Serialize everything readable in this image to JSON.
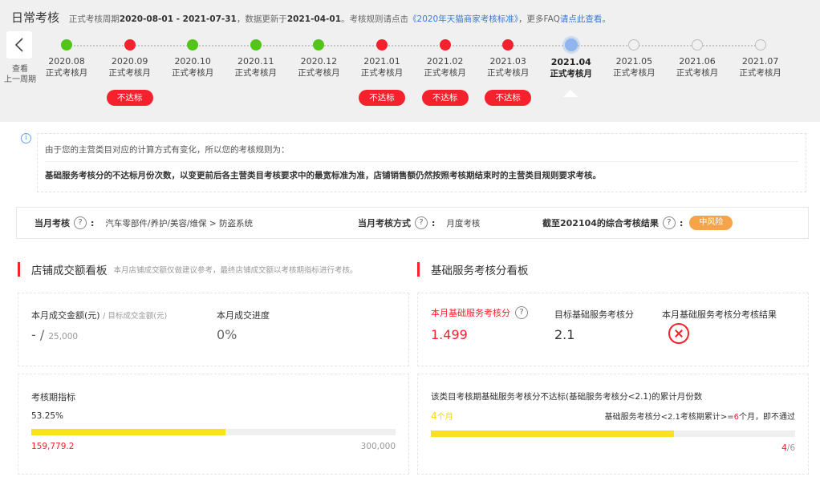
{
  "header": {
    "title": "日常考核",
    "desc_prefix": "正式考核周期",
    "period": "2020-08-01 - 2021-07-31",
    "desc_mid": "，数据更新于",
    "update_date": "2021-04-01",
    "desc_rule": "。考核规则请点击",
    "rule_link": "《2020年天猫商家考核标准》",
    "desc_faq": "，更多FAQ",
    "faq_link": "请点此查看。"
  },
  "timeline": {
    "prev_label_1": "查看",
    "prev_label_2": "上一周期",
    "months": [
      {
        "month": "2020.08",
        "sub": "正式考核月",
        "status": "green",
        "badge": ""
      },
      {
        "month": "2020.09",
        "sub": "正式考核月",
        "status": "red",
        "badge": "不达标"
      },
      {
        "month": "2020.10",
        "sub": "正式考核月",
        "status": "green",
        "badge": ""
      },
      {
        "month": "2020.11",
        "sub": "正式考核月",
        "status": "green",
        "badge": ""
      },
      {
        "month": "2020.12",
        "sub": "正式考核月",
        "status": "green",
        "badge": ""
      },
      {
        "month": "2021.01",
        "sub": "正式考核月",
        "status": "red",
        "badge": "不达标"
      },
      {
        "month": "2021.02",
        "sub": "正式考核月",
        "status": "red",
        "badge": "不达标"
      },
      {
        "month": "2021.03",
        "sub": "正式考核月",
        "status": "red",
        "badge": "不达标"
      },
      {
        "month": "2021.04",
        "sub": "正式考核月",
        "status": "current",
        "badge": ""
      },
      {
        "month": "2021.05",
        "sub": "正式考核月",
        "status": "empty",
        "badge": ""
      },
      {
        "month": "2021.06",
        "sub": "正式考核月",
        "status": "empty",
        "badge": ""
      },
      {
        "month": "2021.07",
        "sub": "正式考核月",
        "status": "empty",
        "badge": ""
      }
    ]
  },
  "notice": {
    "line1": "由于您的主营类目对应的计算方式有变化，所以您的考核规则为：",
    "line2": "基础服务考核分的不达标月份次数，以变更前后各主营类目考核要求中的最宽标准为准，店铺销售额仍然按照考核期结束时的主营类目规则要求考核。"
  },
  "rule_bar": {
    "month_assess_label": "当月考核",
    "category": "汽车零部件/养护/美容/维保 > 防盗系统",
    "method_label": "当月考核方式",
    "method_value": "月度考核",
    "result_label": "截至202104的综合考核结果",
    "risk": "中风险",
    "colon": ":",
    "q": "?"
  },
  "left_section": {
    "title": "店铺成交额看板",
    "note": "本月店铺成交额仅做建议参考，最终店铺成交额以考核期指标进行考核。",
    "deal_label": "本月成交金额(元)",
    "target_label": "/ 目标成交金额(元)",
    "deal_value": "- /",
    "target_value": "25,000",
    "progress_label": "本月成交进度",
    "progress_value": "0%",
    "period_label": "考核期指标",
    "period_pct": "53.25%",
    "period_progress": 0.5325,
    "period_current": "159,779.2",
    "period_target": "300,000"
  },
  "right_section": {
    "title": "基础服务考核分看板",
    "score_label": "本月基础服务考核分",
    "score_value": "1.499",
    "target_label": "目标基础服务考核分",
    "target_value": "2.1",
    "result_label": "本月基础服务考核分考核结果",
    "fail_desc": "该类目考核期基础服务考核分不达标(基础服务考核分<2.1)的累计月份数",
    "fail_months": "4",
    "fail_months_unit": "个月",
    "rule_prefix": "基础服务考核分<2.1考核期累计>=",
    "rule_num": "6",
    "rule_suffix": "个月，即不通过",
    "fail_progress": 0.6667,
    "ratio_num": "4",
    "ratio_den": "/6"
  },
  "colors": {
    "accent_red": "#f5222d",
    "green": "#52c41a",
    "current_blue": "#8fb4ee",
    "risk_orange": "#f7a34a",
    "bar_yellow": "#f8e21c",
    "link_blue": "#3a7bd5"
  }
}
